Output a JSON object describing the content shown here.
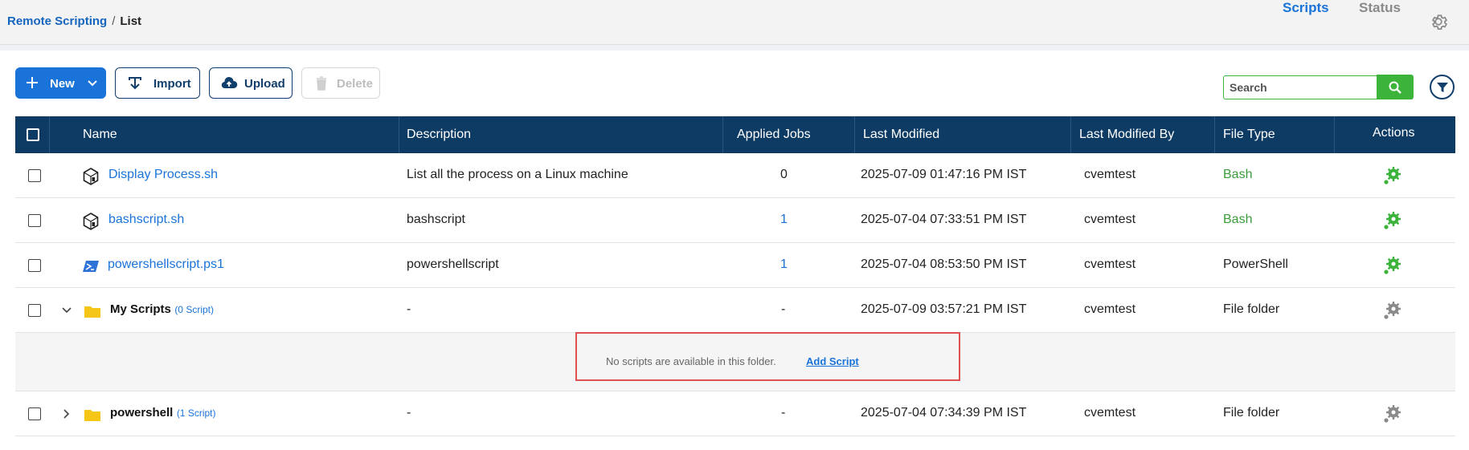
{
  "breadcrumb": {
    "parent": "Remote Scripting",
    "separator": "/",
    "current": "List"
  },
  "nav": {
    "tab_scripts": "Scripts",
    "tab_status": "Status"
  },
  "toolbar": {
    "new_label": "New",
    "import_label": "Import",
    "upload_label": "Upload",
    "delete_label": "Delete"
  },
  "search": {
    "placeholder": "Search",
    "value": ""
  },
  "table": {
    "headers": {
      "name": "Name",
      "description": "Description",
      "applied_jobs": "Applied Jobs",
      "last_modified": "Last Modified",
      "last_modified_by": "Last Modified By",
      "file_type": "File Type",
      "actions": "Actions"
    },
    "rows": [
      {
        "name": "Display Process.sh",
        "description": "List all the process on a Linux machine",
        "applied_jobs": "0",
        "last_modified": "2025-07-09 01:47:16 PM IST",
        "last_modified_by": "cvemtest",
        "file_type": "Bash",
        "icon": "bash-script-icon"
      },
      {
        "name": "bashscript.sh",
        "description": "bashscript",
        "applied_jobs": "1",
        "last_modified": "2025-07-04 07:33:51 PM IST",
        "last_modified_by": "cvemtest",
        "file_type": "Bash",
        "icon": "bash-script-icon"
      },
      {
        "name": "powershellscript.ps1",
        "description": "powershellscript",
        "applied_jobs": "1",
        "last_modified": "2025-07-04 08:53:50 PM IST",
        "last_modified_by": "cvemtest",
        "file_type": "PowerShell",
        "icon": "powershell-script-icon"
      },
      {
        "name": "My Scripts",
        "count": "(0 Script)",
        "description": "-",
        "applied_jobs": "-",
        "last_modified": "2025-07-09 03:57:21 PM IST",
        "last_modified_by": "cvemtest",
        "file_type": "File folder",
        "icon": "folder-icon",
        "expanded": true
      },
      {
        "name": "powershell",
        "count": "(1 Script)",
        "description": "-",
        "applied_jobs": "-",
        "last_modified": "2025-07-04 07:34:39 PM IST",
        "last_modified_by": "cvemtest",
        "file_type": "File folder",
        "icon": "folder-icon",
        "expanded": false
      }
    ],
    "empty_folder": {
      "message": "No scripts are available in this folder.",
      "action": "Add Script"
    }
  },
  "colors": {
    "header_bg": "#0e3b64",
    "accent": "#1a73d9",
    "success": "#3cb43c",
    "highlight_border": "#e05050"
  }
}
